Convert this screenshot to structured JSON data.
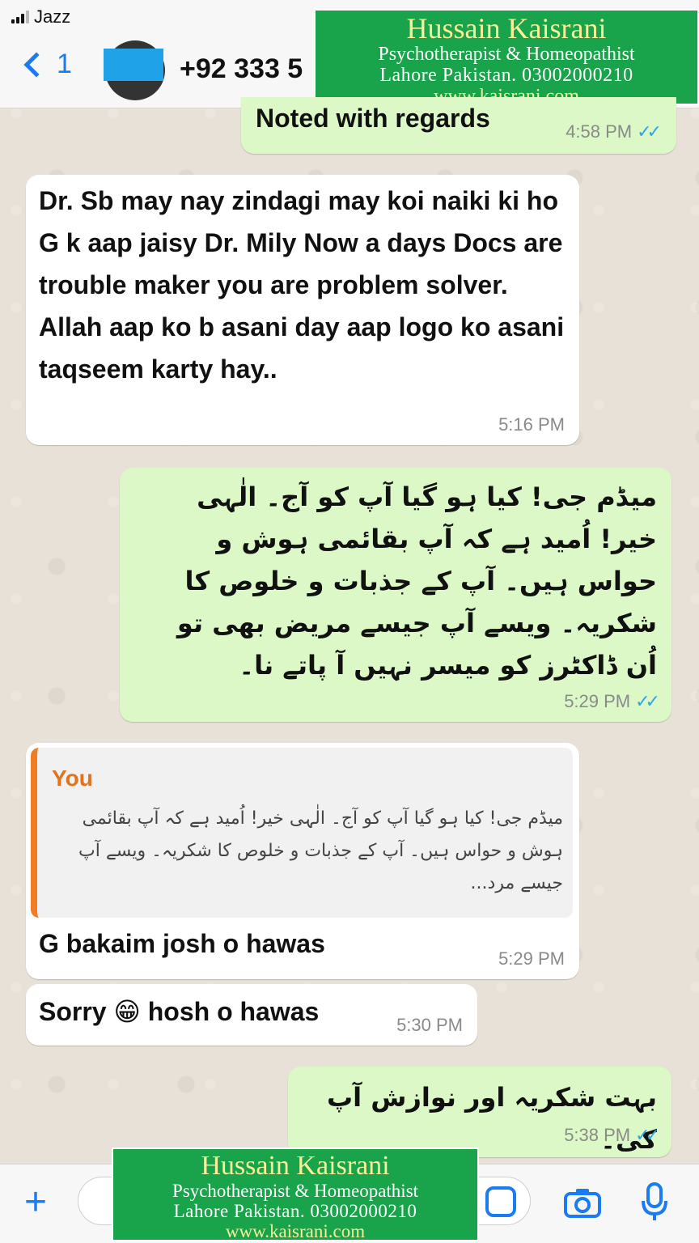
{
  "status_bar": {
    "carrier": "Jazz"
  },
  "header": {
    "back_count": "1",
    "contact_name": "+92 333 5"
  },
  "watermark": {
    "name": "Hussain Kaisrani",
    "title": "Psychotherapist & Homeopathist",
    "location": "Lahore Pakistan. 03002000210",
    "website": "www.kaisrani.com"
  },
  "messages": [
    {
      "direction": "out",
      "text": "Noted with regards",
      "time": "4:58 PM"
    },
    {
      "direction": "in",
      "text": "Dr. Sb may nay zindagi may koi naiki ki ho G k aap jaisy Dr. Mily Now a days Docs are trouble maker you are problem solver. Allah aap ko b asani day aap logo ko asani taqseem karty hay..",
      "time": "5:16 PM"
    },
    {
      "direction": "out",
      "text": "میڈم جی! کیا ہو گیا آپ کو آج۔ الٰہی خیر! اُمید ہے کہ آپ بقائمی ہوش و حواس ہیں۔ آپ کے جذبات و خلوص کا شکریہ۔ ویسے آپ جیسے مریض بھی تو اُن ڈاکٹرز کو میسر نہیں آ پاتے نا۔",
      "time": "5:29 PM"
    },
    {
      "direction": "in",
      "quote_author": "You",
      "quote_text": "میڈم جی! کیا ہو گیا آپ کو آج۔ الٰہی خیر! اُمید ہے کہ آپ بقائمی ہوش و حواس ہیں۔ آپ کے جذبات و خلوص کا شکریہ۔ ویسے آپ جیسے مرد...",
      "text": "G bakaim josh o hawas",
      "time": "5:29 PM"
    },
    {
      "direction": "in",
      "text": "Sorry 😁 hosh o hawas",
      "time": "5:30 PM"
    },
    {
      "direction": "out",
      "text": "بہت شکریہ اور نوازش آپ کی۔",
      "time": "5:38 PM"
    }
  ],
  "read_ticks": "✓✓",
  "input_bar": {
    "plus": "+"
  },
  "colors": {
    "accent": "#1a7cf0",
    "outgoing": "#dcf8c6",
    "incoming": "#ffffff",
    "banner": "#19a34a"
  }
}
